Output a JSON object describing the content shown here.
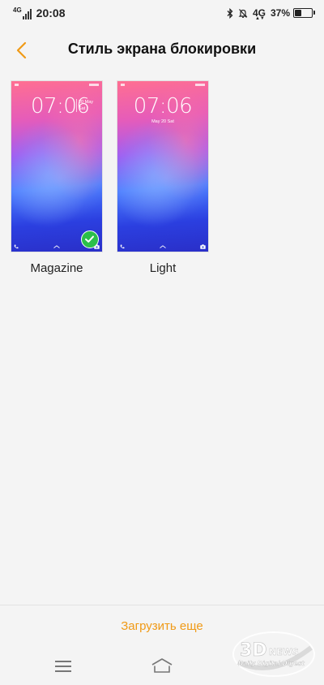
{
  "status_bar": {
    "network_left": "4G",
    "time": "20:08",
    "network_right": "4G",
    "battery_percent": "37%",
    "battery_level": 0.37
  },
  "header": {
    "title": "Стиль экрана блокировки"
  },
  "styles": [
    {
      "label": "Magazine",
      "preview_time": "07:06",
      "preview_date_line1": "20 May",
      "preview_date_line2": "Sat",
      "selected": true
    },
    {
      "label": "Light",
      "preview_time": "07:06",
      "preview_date": "May 20  Sat",
      "selected": false
    }
  ],
  "footer": {
    "download_more_label": "Загрузить еще"
  },
  "watermark": {
    "logo_text": "3DNEWS",
    "tagline": "Daily Digital Digest"
  },
  "colors": {
    "accent": "#f09a16",
    "check": "#2bbf4a",
    "background": "#f4f4f4"
  }
}
